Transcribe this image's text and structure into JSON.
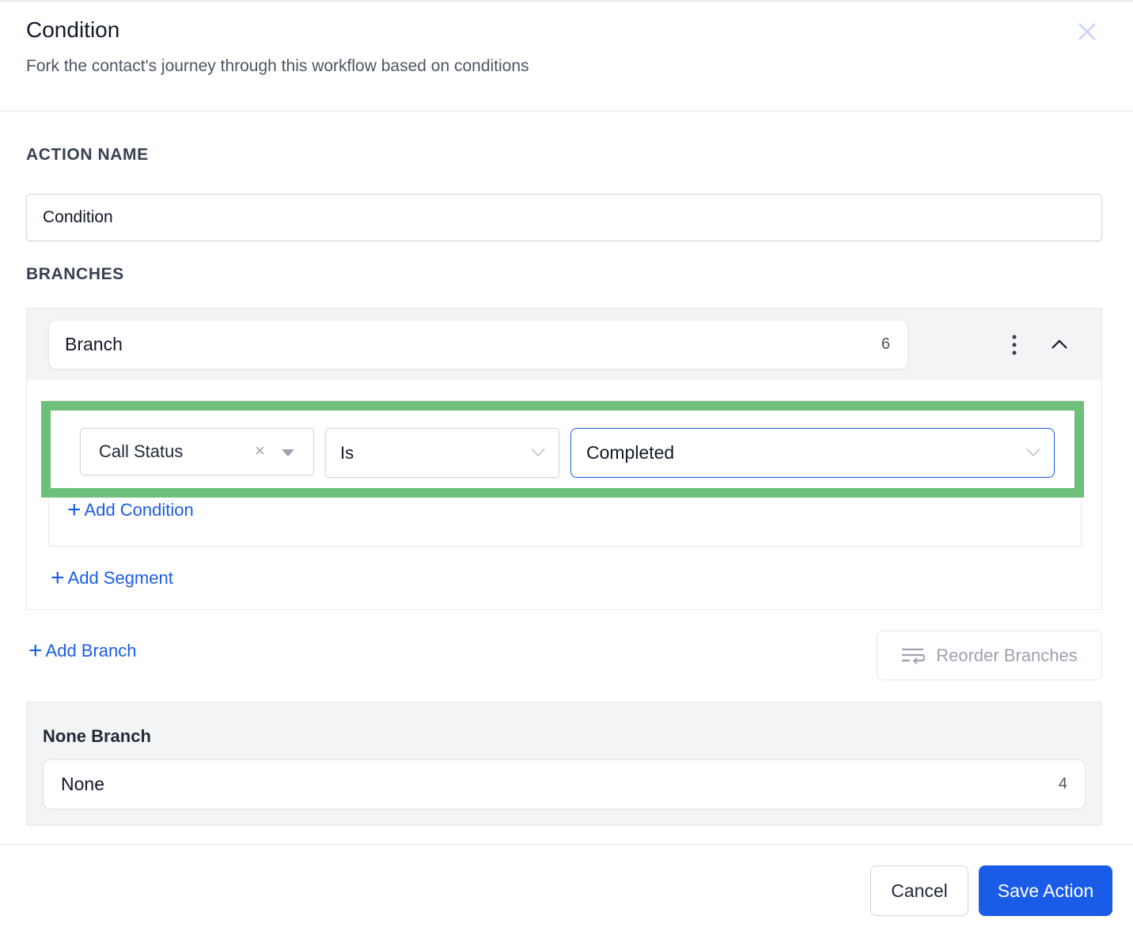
{
  "header": {
    "title": "Condition",
    "subtitle": "Fork the contact's journey through this workflow based on conditions",
    "close_icon": "close-icon"
  },
  "action_name": {
    "label": "ACTION NAME",
    "value": "Condition"
  },
  "branches": {
    "label": "BRANCHES",
    "items": [
      {
        "name": "Branch",
        "count": "6",
        "conditions": [
          {
            "field": "Call Status",
            "operator": "Is",
            "value": "Completed"
          }
        ],
        "add_condition": "Add Condition",
        "add_segment": "Add Segment"
      }
    ],
    "add_branch": "Add Branch",
    "reorder": "Reorder Branches"
  },
  "none_branch": {
    "title": "None Branch",
    "name": "None",
    "count": "4"
  },
  "footer": {
    "cancel": "Cancel",
    "save": "Save Action"
  },
  "colors": {
    "primary": "#1a5ce8",
    "highlight": "#6ebf7a"
  }
}
